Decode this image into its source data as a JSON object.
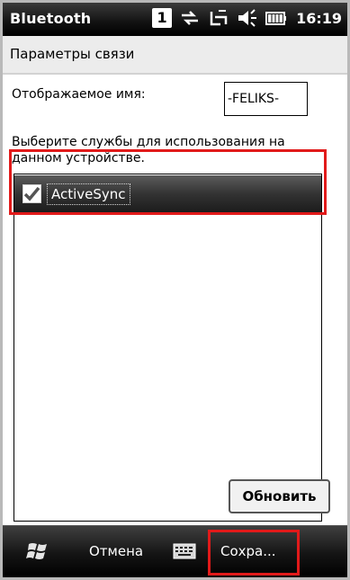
{
  "status_bar": {
    "title": "Bluetooth",
    "badge": "1",
    "time": "16:19",
    "icons": [
      "sim-card-icon",
      "sync-arrows-icon",
      "no-signal-icon",
      "speaker-icon",
      "battery-icon"
    ]
  },
  "header": {
    "title": "Параметры связи"
  },
  "form": {
    "display_name_label": "Отображаемое имя:",
    "display_name_value": "-FELIKS-",
    "services_prompt": "Выберите службы для использования на данном устройстве."
  },
  "services": [
    {
      "label": "ActiveSync",
      "checked": true,
      "selected": true
    }
  ],
  "buttons": {
    "refresh_label": "Обновить"
  },
  "softkeys": {
    "left": "Отмена",
    "right": "Сохра..."
  },
  "colors": {
    "highlight_red": "#e11a1a",
    "row_dark": "#2a2a2a"
  }
}
